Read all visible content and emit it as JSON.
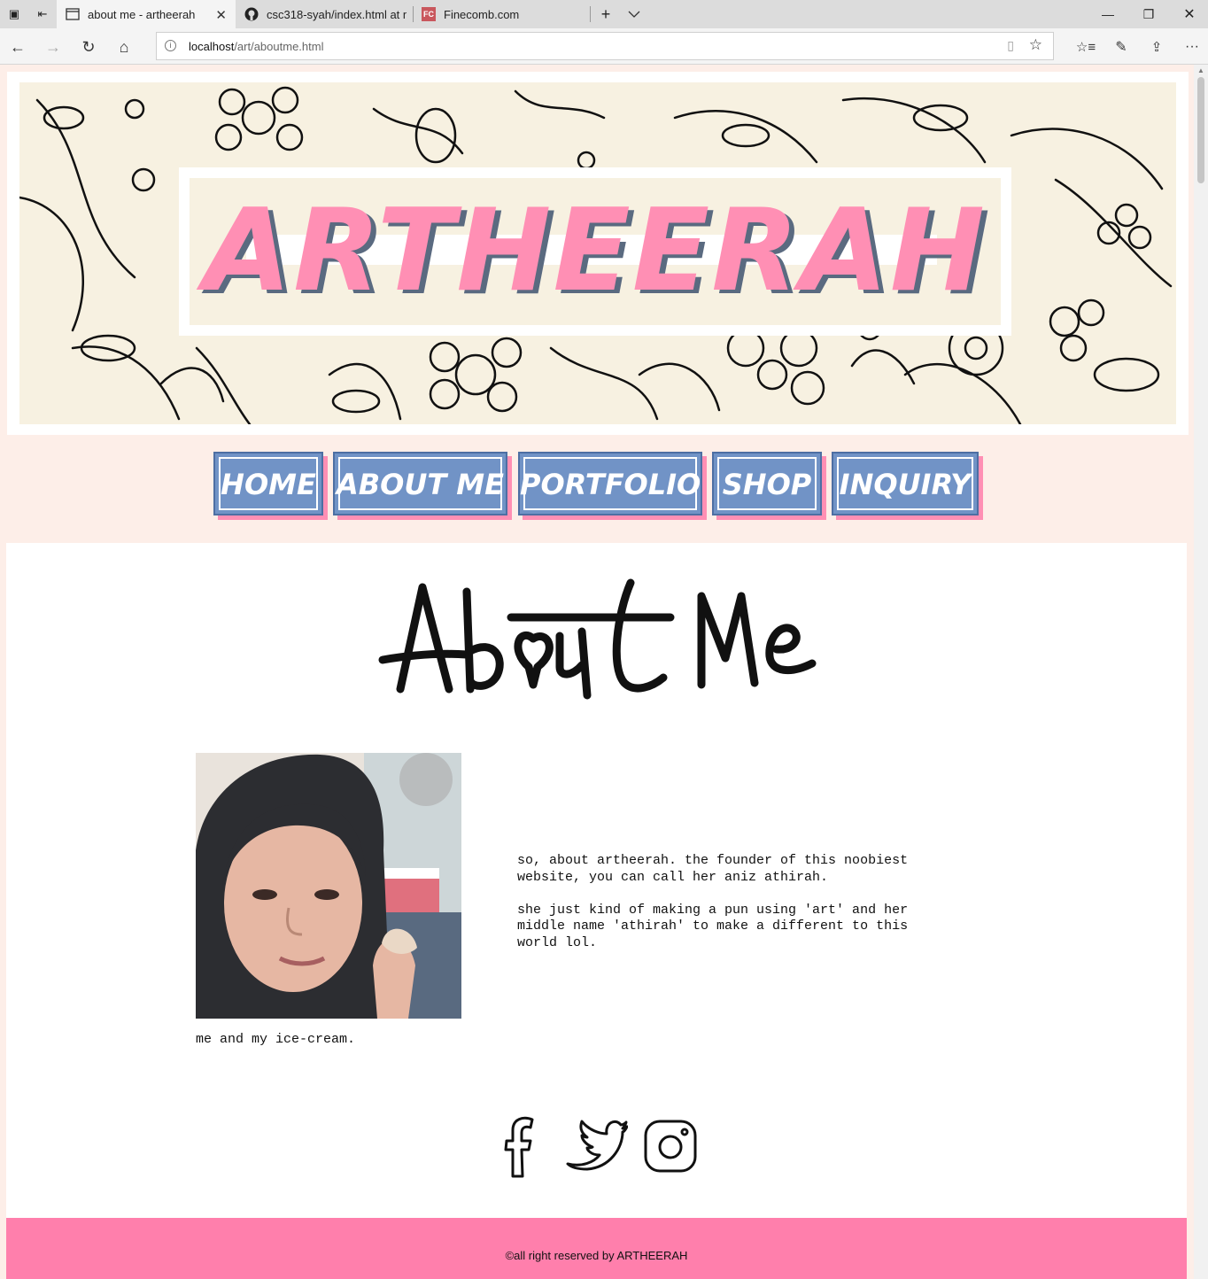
{
  "browser": {
    "tabs": [
      {
        "title": "about me - artheerah",
        "active": true
      },
      {
        "title": "csc318-syah/index.html at n",
        "active": false
      },
      {
        "title": "Finecomb.com",
        "active": false
      }
    ],
    "favicon_fc": "FC",
    "url_host": "localhost",
    "url_path": "/art/aboutme.html"
  },
  "header": {
    "logo": "ARTHEERAH"
  },
  "nav": {
    "items": [
      "HOME",
      "ABOUT ME",
      "PORTFOLIO",
      "SHOP",
      "INQUIRY"
    ]
  },
  "about": {
    "title": "About Me",
    "caption": "me and my ice-cream.",
    "bio": [
      "so, about artheerah. the founder of this noobiest\nwebsite, you can call her aniz athirah.",
      "she just kind of making a pun using 'art' and her\nmiddle name 'athirah' to make a different to this\nworld lol."
    ]
  },
  "social": {
    "icons": [
      "facebook-icon",
      "twitter-icon",
      "instagram-icon"
    ]
  },
  "footer": {
    "text": "©all right reserved by ARTHEERAH"
  },
  "colors": {
    "page_bg": "#fdeee8",
    "nav_blue": "#7193c6",
    "accent_pink": "#ff8fb4",
    "footer_pink": "#ff7fac",
    "header_cream": "#f7f1e1"
  }
}
